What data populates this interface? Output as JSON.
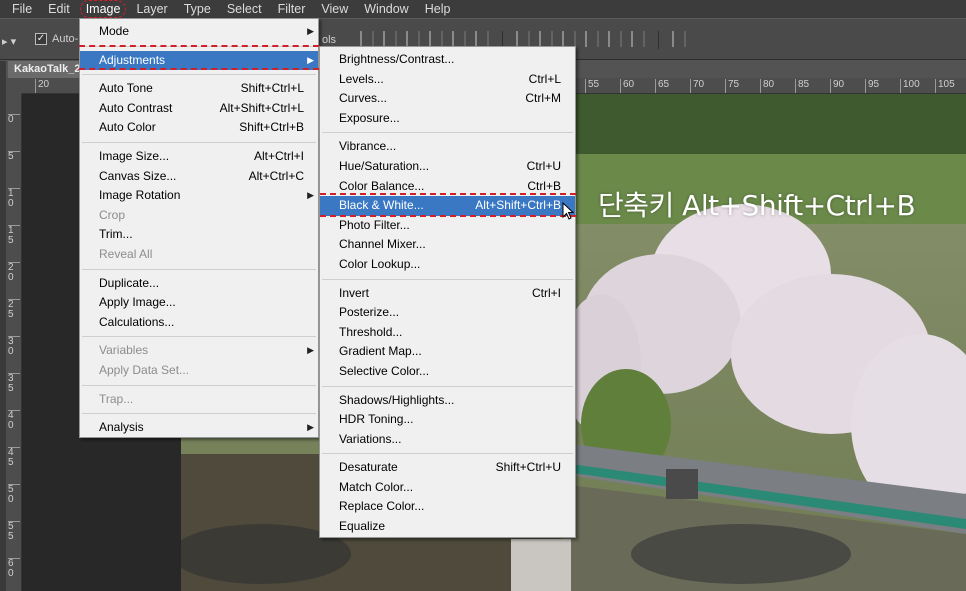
{
  "menubar": {
    "items": [
      "File",
      "Edit",
      "Image",
      "Layer",
      "Type",
      "Select",
      "Filter",
      "View",
      "Window",
      "Help"
    ],
    "active_index": 2
  },
  "options_bar": {
    "checkbox_label": "Auto-",
    "ols_text": "ols"
  },
  "document": {
    "tab_title": "KakaoTalk_2"
  },
  "ruler": {
    "h_ticks": [
      "20",
      "55",
      "60",
      "65",
      "70",
      "75",
      "80",
      "85",
      "90",
      "95",
      "100",
      "105"
    ],
    "v_ticks": [
      "0",
      "5",
      "1 0",
      "1 5",
      "2 0",
      "2 5",
      "3 0",
      "3 5",
      "4 0",
      "4 5",
      "5 0",
      "5 5",
      "6 0"
    ]
  },
  "caption": "단축키 Alt+Shift+Ctrl+B",
  "image_menu": {
    "groups": [
      [
        {
          "label": "Mode",
          "submenu": true
        }
      ],
      [
        {
          "label": "Adjustments",
          "submenu": true,
          "highlight": true
        }
      ],
      [
        {
          "label": "Auto Tone",
          "shortcut": "Shift+Ctrl+L"
        },
        {
          "label": "Auto Contrast",
          "shortcut": "Alt+Shift+Ctrl+L"
        },
        {
          "label": "Auto Color",
          "shortcut": "Shift+Ctrl+B"
        }
      ],
      [
        {
          "label": "Image Size...",
          "shortcut": "Alt+Ctrl+I"
        },
        {
          "label": "Canvas Size...",
          "shortcut": "Alt+Ctrl+C"
        },
        {
          "label": "Image Rotation",
          "submenu": true
        },
        {
          "label": "Crop",
          "disabled": true
        },
        {
          "label": "Trim..."
        },
        {
          "label": "Reveal All",
          "disabled": true
        }
      ],
      [
        {
          "label": "Duplicate..."
        },
        {
          "label": "Apply Image..."
        },
        {
          "label": "Calculations..."
        }
      ],
      [
        {
          "label": "Variables",
          "submenu": true,
          "disabled": true
        },
        {
          "label": "Apply Data Set...",
          "disabled": true
        }
      ],
      [
        {
          "label": "Trap...",
          "disabled": true
        }
      ],
      [
        {
          "label": "Analysis",
          "submenu": true
        }
      ]
    ]
  },
  "adjustments_menu": {
    "groups": [
      [
        {
          "label": "Brightness/Contrast..."
        },
        {
          "label": "Levels...",
          "shortcut": "Ctrl+L"
        },
        {
          "label": "Curves...",
          "shortcut": "Ctrl+M"
        },
        {
          "label": "Exposure..."
        }
      ],
      [
        {
          "label": "Vibrance..."
        },
        {
          "label": "Hue/Saturation...",
          "shortcut": "Ctrl+U"
        },
        {
          "label": "Color Balance...",
          "shortcut": "Ctrl+B"
        },
        {
          "label": "Black & White...",
          "shortcut": "Alt+Shift+Ctrl+B",
          "highlight": true
        },
        {
          "label": "Photo Filter..."
        },
        {
          "label": "Channel Mixer..."
        },
        {
          "label": "Color Lookup..."
        }
      ],
      [
        {
          "label": "Invert",
          "shortcut": "Ctrl+I"
        },
        {
          "label": "Posterize..."
        },
        {
          "label": "Threshold..."
        },
        {
          "label": "Gradient Map..."
        },
        {
          "label": "Selective Color..."
        }
      ],
      [
        {
          "label": "Shadows/Highlights..."
        },
        {
          "label": "HDR Toning..."
        },
        {
          "label": "Variations..."
        }
      ],
      [
        {
          "label": "Desaturate",
          "shortcut": "Shift+Ctrl+U"
        },
        {
          "label": "Match Color..."
        },
        {
          "label": "Replace Color..."
        },
        {
          "label": "Equalize"
        }
      ]
    ]
  },
  "colors": {
    "highlight": "#3a78c4",
    "annotation": "#d0202a"
  }
}
